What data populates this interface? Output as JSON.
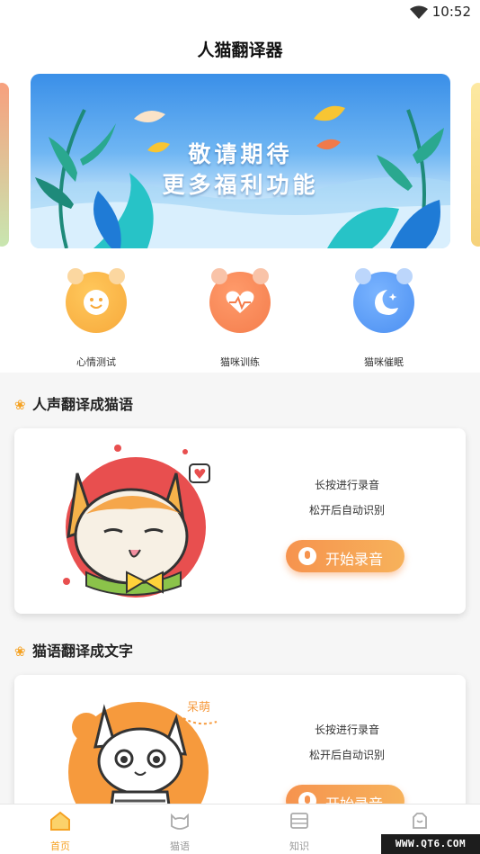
{
  "status_bar": {
    "time": "10:52",
    "wifi_icon": "wifi-icon"
  },
  "header": {
    "title": "人猫翻译器"
  },
  "banner": {
    "line1": "敬请期待",
    "line2": "更多福利功能"
  },
  "features": [
    {
      "label": "心情测试",
      "icon": "smiley-icon",
      "color": "#f7a93b"
    },
    {
      "label": "猫咪训练",
      "icon": "heart-pulse-icon",
      "color": "#f47d4c"
    },
    {
      "label": "猫咪催眠",
      "icon": "moon-star-icon",
      "color": "#4b8ff1"
    }
  ],
  "section1": {
    "title": "人声翻译成猫语",
    "hint1": "长按进行录音",
    "hint2": "松开后自动识别",
    "button": "开始录音"
  },
  "section2": {
    "title": "猫语翻译成文字",
    "hint1": "长按进行录音",
    "hint2": "松开后自动识别",
    "button": "开始录音",
    "sticker_text": "呆萌"
  },
  "bottom_nav": [
    {
      "label": "首页",
      "icon": "home-icon",
      "active": true
    },
    {
      "label": "猫语",
      "icon": "cat-face-icon",
      "active": false
    },
    {
      "label": "知识",
      "icon": "book-icon",
      "active": false
    },
    {
      "label": "",
      "icon": "profile-icon",
      "active": false
    }
  ],
  "watermark": "WWW.QT6.COM",
  "colors": {
    "accent": "#f5a223",
    "button_start": "#f6934e",
    "button_end": "#f7b25b"
  }
}
